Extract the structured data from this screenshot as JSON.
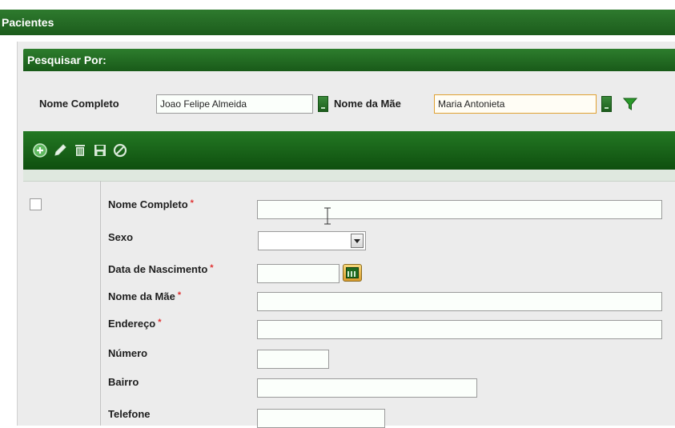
{
  "window": {
    "title": "Pacientes"
  },
  "search": {
    "header": "Pesquisar Por:",
    "nome_completo": {
      "label": "Nome Completo",
      "value": "Joao Felipe Almeida"
    },
    "nome_mae": {
      "label": "Nome da Mãe",
      "value": "Maria Antonieta"
    }
  },
  "toolbar": {
    "icons": [
      "add-icon",
      "edit-pencil-icon",
      "delete-trash-icon",
      "save-icon",
      "cancel-icon"
    ]
  },
  "form": {
    "nome_completo_label": "Nome Completo",
    "sexo_label": "Sexo",
    "data_nascimento_label": "Data de Nascimento",
    "nome_mae_label": "Nome da Mãe",
    "endereco_label": "Endereço",
    "numero_label": "Número",
    "bairro_label": "Bairro",
    "telefone_label": "Telefone",
    "required_mark": "*"
  },
  "colors": {
    "header_green": "#1c5c1c",
    "accent_orange": "#e0a030",
    "required_red": "#e03030"
  }
}
